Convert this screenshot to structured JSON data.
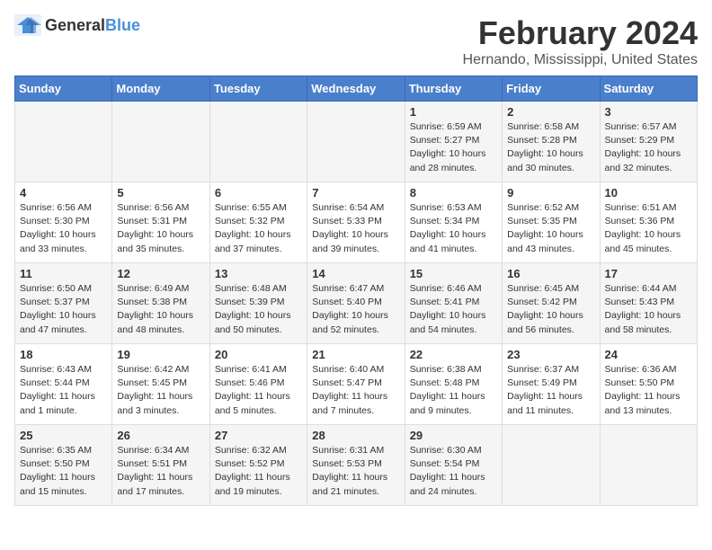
{
  "logo": {
    "text_general": "General",
    "text_blue": "Blue"
  },
  "header": {
    "title": "February 2024",
    "subtitle": "Hernando, Mississippi, United States"
  },
  "weekdays": [
    "Sunday",
    "Monday",
    "Tuesday",
    "Wednesday",
    "Thursday",
    "Friday",
    "Saturday"
  ],
  "weeks": [
    [
      {
        "day": "",
        "info": ""
      },
      {
        "day": "",
        "info": ""
      },
      {
        "day": "",
        "info": ""
      },
      {
        "day": "",
        "info": ""
      },
      {
        "day": "1",
        "info": "Sunrise: 6:59 AM\nSunset: 5:27 PM\nDaylight: 10 hours\nand 28 minutes."
      },
      {
        "day": "2",
        "info": "Sunrise: 6:58 AM\nSunset: 5:28 PM\nDaylight: 10 hours\nand 30 minutes."
      },
      {
        "day": "3",
        "info": "Sunrise: 6:57 AM\nSunset: 5:29 PM\nDaylight: 10 hours\nand 32 minutes."
      }
    ],
    [
      {
        "day": "4",
        "info": "Sunrise: 6:56 AM\nSunset: 5:30 PM\nDaylight: 10 hours\nand 33 minutes."
      },
      {
        "day": "5",
        "info": "Sunrise: 6:56 AM\nSunset: 5:31 PM\nDaylight: 10 hours\nand 35 minutes."
      },
      {
        "day": "6",
        "info": "Sunrise: 6:55 AM\nSunset: 5:32 PM\nDaylight: 10 hours\nand 37 minutes."
      },
      {
        "day": "7",
        "info": "Sunrise: 6:54 AM\nSunset: 5:33 PM\nDaylight: 10 hours\nand 39 minutes."
      },
      {
        "day": "8",
        "info": "Sunrise: 6:53 AM\nSunset: 5:34 PM\nDaylight: 10 hours\nand 41 minutes."
      },
      {
        "day": "9",
        "info": "Sunrise: 6:52 AM\nSunset: 5:35 PM\nDaylight: 10 hours\nand 43 minutes."
      },
      {
        "day": "10",
        "info": "Sunrise: 6:51 AM\nSunset: 5:36 PM\nDaylight: 10 hours\nand 45 minutes."
      }
    ],
    [
      {
        "day": "11",
        "info": "Sunrise: 6:50 AM\nSunset: 5:37 PM\nDaylight: 10 hours\nand 47 minutes."
      },
      {
        "day": "12",
        "info": "Sunrise: 6:49 AM\nSunset: 5:38 PM\nDaylight: 10 hours\nand 48 minutes."
      },
      {
        "day": "13",
        "info": "Sunrise: 6:48 AM\nSunset: 5:39 PM\nDaylight: 10 hours\nand 50 minutes."
      },
      {
        "day": "14",
        "info": "Sunrise: 6:47 AM\nSunset: 5:40 PM\nDaylight: 10 hours\nand 52 minutes."
      },
      {
        "day": "15",
        "info": "Sunrise: 6:46 AM\nSunset: 5:41 PM\nDaylight: 10 hours\nand 54 minutes."
      },
      {
        "day": "16",
        "info": "Sunrise: 6:45 AM\nSunset: 5:42 PM\nDaylight: 10 hours\nand 56 minutes."
      },
      {
        "day": "17",
        "info": "Sunrise: 6:44 AM\nSunset: 5:43 PM\nDaylight: 10 hours\nand 58 minutes."
      }
    ],
    [
      {
        "day": "18",
        "info": "Sunrise: 6:43 AM\nSunset: 5:44 PM\nDaylight: 11 hours\nand 1 minute."
      },
      {
        "day": "19",
        "info": "Sunrise: 6:42 AM\nSunset: 5:45 PM\nDaylight: 11 hours\nand 3 minutes."
      },
      {
        "day": "20",
        "info": "Sunrise: 6:41 AM\nSunset: 5:46 PM\nDaylight: 11 hours\nand 5 minutes."
      },
      {
        "day": "21",
        "info": "Sunrise: 6:40 AM\nSunset: 5:47 PM\nDaylight: 11 hours\nand 7 minutes."
      },
      {
        "day": "22",
        "info": "Sunrise: 6:38 AM\nSunset: 5:48 PM\nDaylight: 11 hours\nand 9 minutes."
      },
      {
        "day": "23",
        "info": "Sunrise: 6:37 AM\nSunset: 5:49 PM\nDaylight: 11 hours\nand 11 minutes."
      },
      {
        "day": "24",
        "info": "Sunrise: 6:36 AM\nSunset: 5:50 PM\nDaylight: 11 hours\nand 13 minutes."
      }
    ],
    [
      {
        "day": "25",
        "info": "Sunrise: 6:35 AM\nSunset: 5:50 PM\nDaylight: 11 hours\nand 15 minutes."
      },
      {
        "day": "26",
        "info": "Sunrise: 6:34 AM\nSunset: 5:51 PM\nDaylight: 11 hours\nand 17 minutes."
      },
      {
        "day": "27",
        "info": "Sunrise: 6:32 AM\nSunset: 5:52 PM\nDaylight: 11 hours\nand 19 minutes."
      },
      {
        "day": "28",
        "info": "Sunrise: 6:31 AM\nSunset: 5:53 PM\nDaylight: 11 hours\nand 21 minutes."
      },
      {
        "day": "29",
        "info": "Sunrise: 6:30 AM\nSunset: 5:54 PM\nDaylight: 11 hours\nand 24 minutes."
      },
      {
        "day": "",
        "info": ""
      },
      {
        "day": "",
        "info": ""
      }
    ]
  ]
}
